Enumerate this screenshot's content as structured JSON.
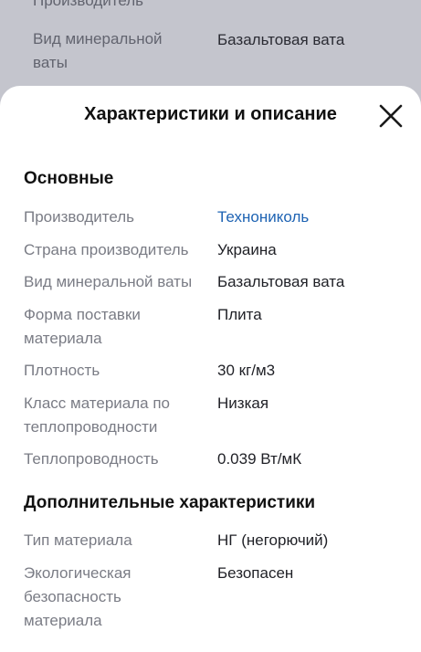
{
  "background": {
    "top_fragment": "Производитель",
    "label_line1": "Вид минеральной",
    "label_line2": "ваты",
    "value": "Базальтовая вата"
  },
  "sheet": {
    "title": "Характеристики и описание",
    "close_icon": "close-x-icon",
    "sections": [
      {
        "title": "Основные",
        "rows": [
          {
            "label": "Производитель",
            "value": "Технониколь",
            "link": true
          },
          {
            "label": "Страна производитель",
            "value": "Украина"
          },
          {
            "label": "Вид минеральной ваты",
            "value": "Базальтовая вата"
          },
          {
            "label_line1": "Форма поставки",
            "label_line2": "материала",
            "value": "Плита"
          },
          {
            "label": "Плотность",
            "value": "30 кг/м3"
          },
          {
            "label_line1": "Класс материала по",
            "label_line2": "теплопроводности",
            "value": "Низкая"
          },
          {
            "label": "Теплопроводность",
            "value": "0.039 Вт/мК"
          }
        ]
      },
      {
        "title": "Дополнительные характеристики",
        "rows": [
          {
            "label": "Тип материала",
            "value": "НГ (негорючий)"
          },
          {
            "label_line1": "Экологическая",
            "label_line2": "безопасность",
            "label_line3": "материала",
            "value": "Безопасен"
          }
        ]
      }
    ]
  }
}
